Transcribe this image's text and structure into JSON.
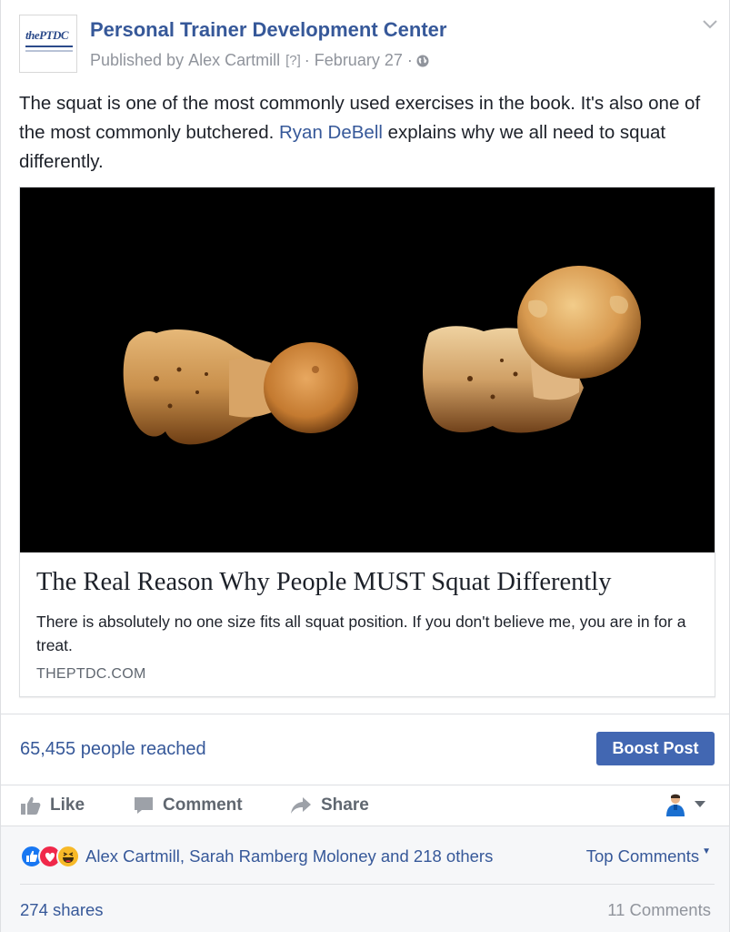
{
  "header": {
    "logo_text": "thePTDC",
    "page_name": "Personal Trainer Development Center",
    "published_prefix": "Published by",
    "publisher": "Alex Cartmill",
    "help_marker": "[?]",
    "separator": "·",
    "date": "February 27",
    "privacy_icon": "globe-icon",
    "menu_icon": "chevron-down-icon"
  },
  "post": {
    "text_before": "The squat is one of the most commonly used exercises in the book. It's also one of the most commonly butchered.",
    "mention": "Ryan DeBell",
    "text_after": "explains why we all need to squat differently."
  },
  "link_card": {
    "title": "The Real Reason Why People MUST Squat Differently",
    "description": "There is absolutely no one size fits all squat position. If you don't believe me, you are in for a treat.",
    "domain": "THEPTDC.COM"
  },
  "insights": {
    "reach": "65,455 people reached",
    "boost_label": "Boost Post"
  },
  "actions": {
    "like": "Like",
    "comment": "Comment",
    "share": "Share",
    "like_icon": "thumbs-up-icon",
    "comment_icon": "speech-bubble-icon",
    "share_icon": "share-arrow-icon"
  },
  "footer": {
    "reactions": [
      "like",
      "love",
      "haha"
    ],
    "reaction_names": "Alex Cartmill, Sarah Ramberg Moloney and 218 others",
    "top_comments": "Top Comments",
    "shares": "274 shares",
    "comments": "11 Comments"
  },
  "colors": {
    "link_blue": "#365899",
    "button_blue": "#4267b2",
    "muted_gray": "#90949c",
    "like_blue": "#1877f2",
    "love_red": "#f0284a",
    "haha_yellow": "#f7b928"
  }
}
